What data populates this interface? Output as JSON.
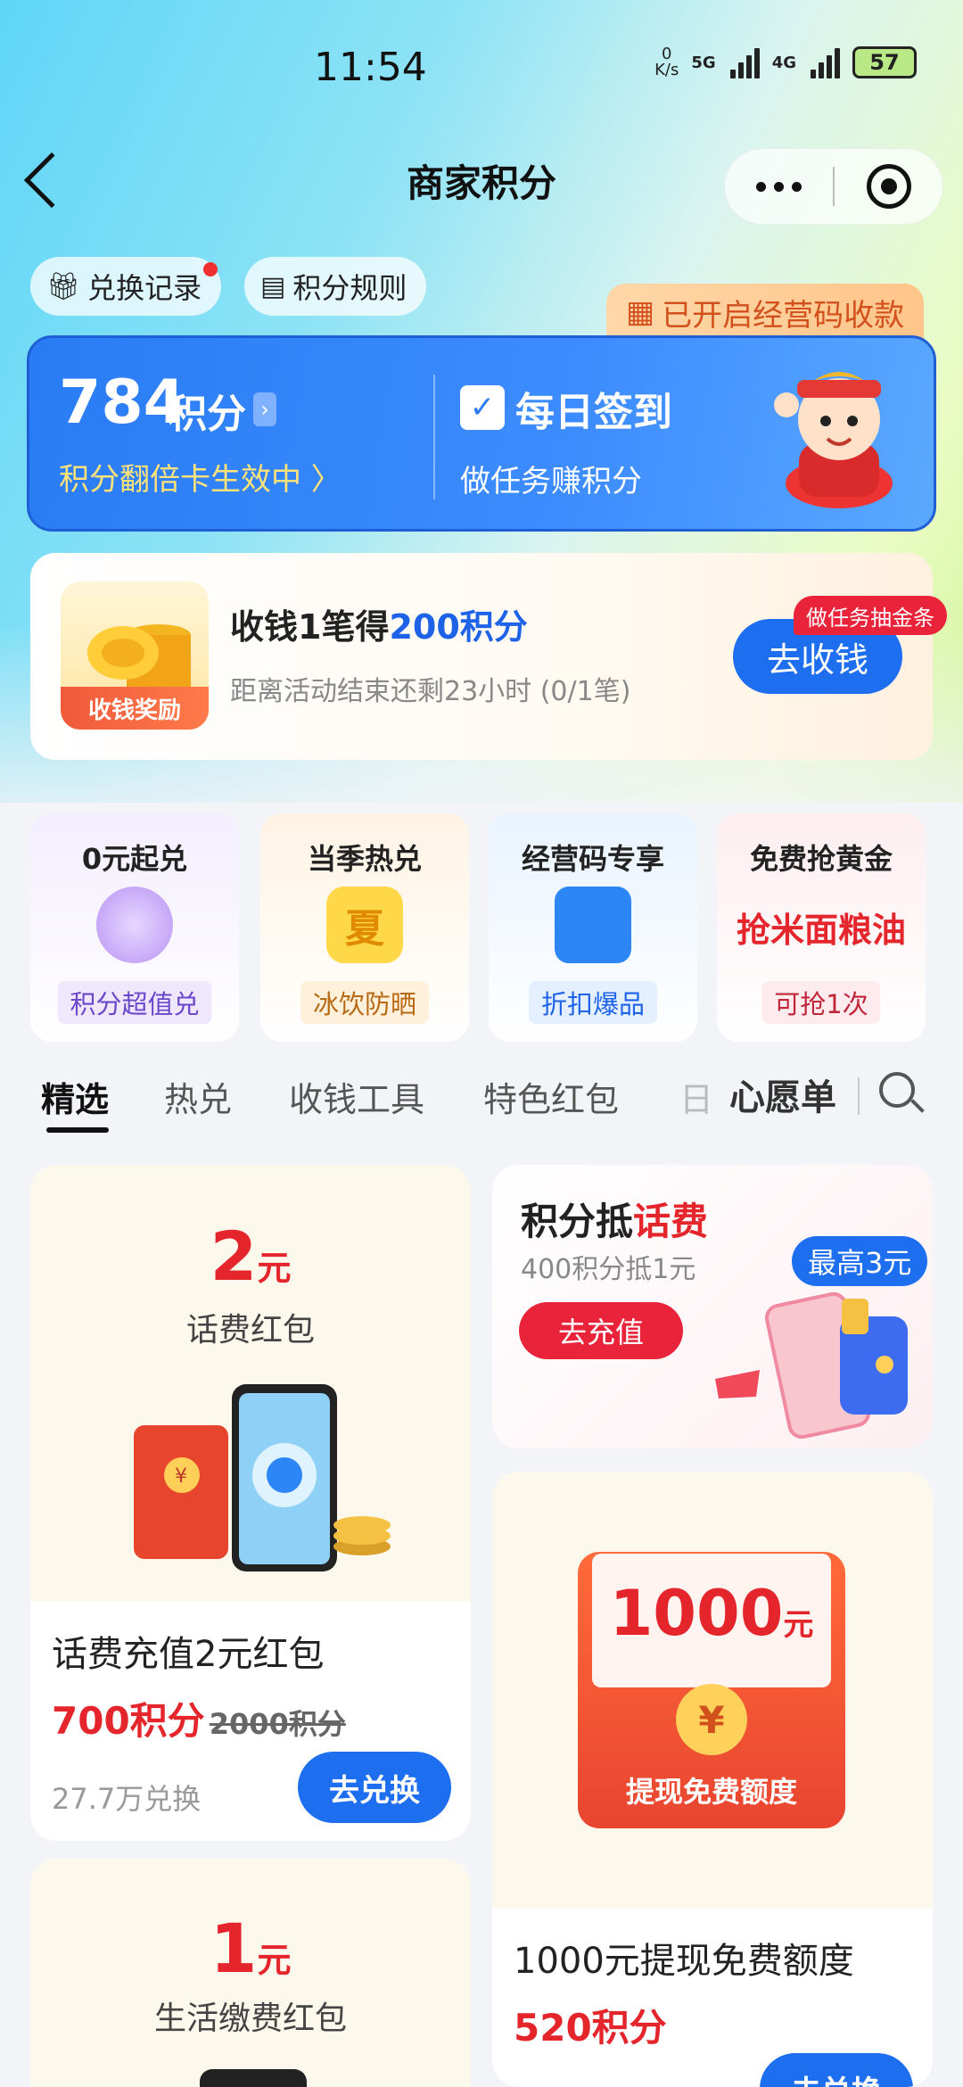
{
  "status_bar": {
    "time": "11:54",
    "net_speed_value": "0",
    "net_speed_unit": "K/s",
    "gen1": "5G",
    "gen2": "4G",
    "battery": "57"
  },
  "nav": {
    "title": "商家积分"
  },
  "pills": {
    "exchange_record": "兑换记录",
    "points_rules": "积分规则"
  },
  "merchant_tag": "已开启经营码收款",
  "points_card": {
    "points": "784",
    "unit": "积分",
    "double_card": "积分翻倍卡生效中 〉",
    "sign_in": "每日签到",
    "do_task": "做任务赚积分"
  },
  "task_card": {
    "image_tag": "收钱奖励",
    "title_prefix": "收钱1笔得",
    "title_highlight": "200积分",
    "subtitle": "距离活动结束还剩23小时 (0/1笔)",
    "button": "去收钱",
    "badge": "做任务抽金条"
  },
  "categories": [
    {
      "title": "0元起兑",
      "badge": "积分超值兑"
    },
    {
      "title": "当季热兑",
      "badge": "冰饮防晒",
      "icon_char": "夏"
    },
    {
      "title": "经营码专享",
      "badge": "折扣爆品"
    },
    {
      "title": "免费抢黄金",
      "badge": "可抢1次",
      "promo": "抢米面粮油"
    }
  ],
  "tabs": [
    "精选",
    "热兑",
    "收钱工具",
    "特色红包",
    "日"
  ],
  "wishlist": "心愿单",
  "products": {
    "p1": {
      "amount": "2",
      "unit": "元",
      "label": "话费红包",
      "name": "话费充值2元红包",
      "price": "700积分",
      "orig_price": "2000积分",
      "sold": "27.7万兑换",
      "button": "去兑换",
      "currency": "¥"
    },
    "p2": {
      "title_a": "积分抵",
      "title_b": "话费",
      "subtitle": "400积分抵1元",
      "button": "去充值",
      "badge": "最高3元"
    },
    "p3": {
      "amount": "1000",
      "unit": "元",
      "currency": "¥",
      "label": "提现免费额度",
      "name": "1000元提现免费额度",
      "price": "520积分",
      "button": "去兑换"
    },
    "p4": {
      "amount": "1",
      "unit": "元",
      "label": "生活缴费红包"
    }
  }
}
